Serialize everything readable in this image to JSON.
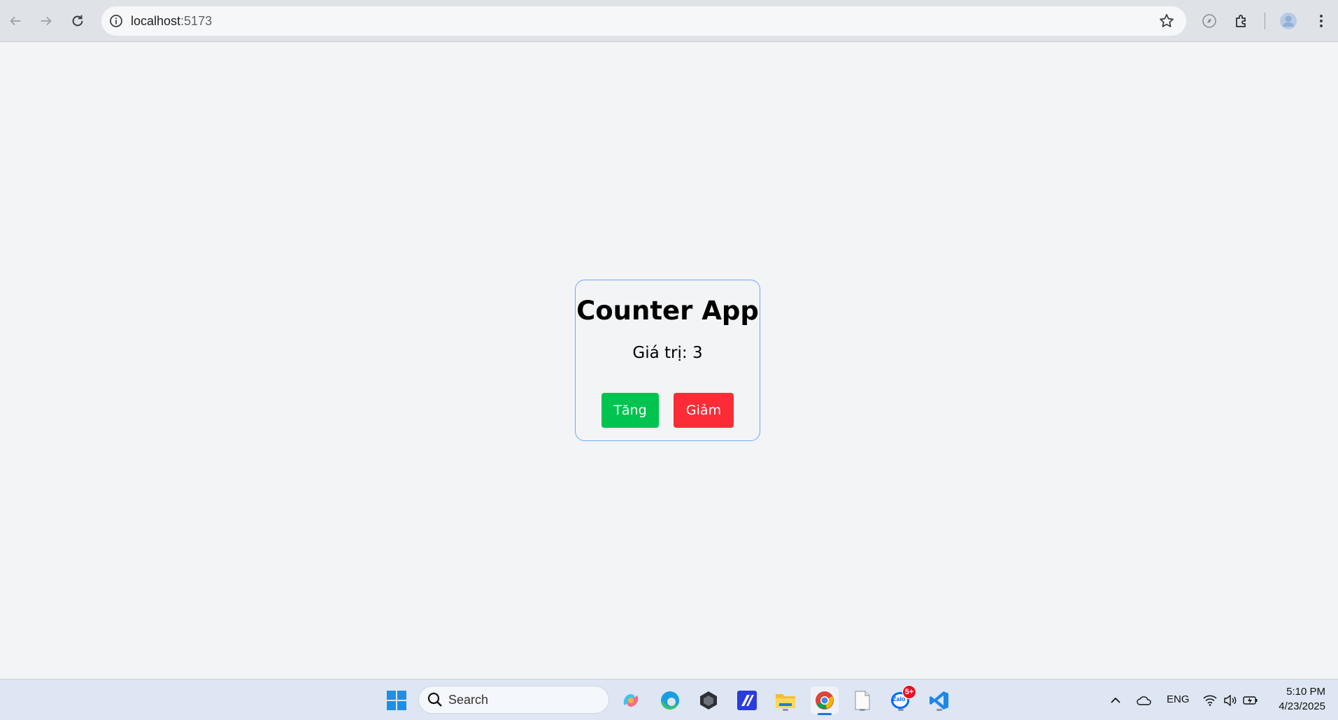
{
  "browser": {
    "url_host": "localhost",
    "url_port": ":5173",
    "icons": [
      "back-arrow-icon",
      "forward-arrow-icon",
      "reload-icon",
      "site-info-icon",
      "bookmark-star-icon",
      "extension-compass-icon",
      "extensions-puzzle-icon",
      "profile-avatar-icon",
      "more-menu-icon"
    ]
  },
  "app": {
    "title": "Counter App",
    "value_label": "Giá trị: 3",
    "increment_label": "Tăng",
    "decrement_label": "Giảm",
    "colors": {
      "increment": "#00c44f",
      "decrement": "#fb2c36",
      "card_border": "#6ea8fe"
    }
  },
  "taskbar": {
    "search_placeholder": "Search",
    "apps": [
      "windows-start-icon",
      "copilot-icon",
      "edge-icon",
      "app-cube-icon",
      "visual-studio-icon",
      "file-explorer-icon",
      "chrome-icon",
      "notepad-icon",
      "zalo-icon",
      "vscode-icon"
    ],
    "zalo_badge": "5+",
    "zalo_label": "Zalo",
    "language": "ENG",
    "time": "5:10 PM",
    "date": "4/23/2025"
  }
}
